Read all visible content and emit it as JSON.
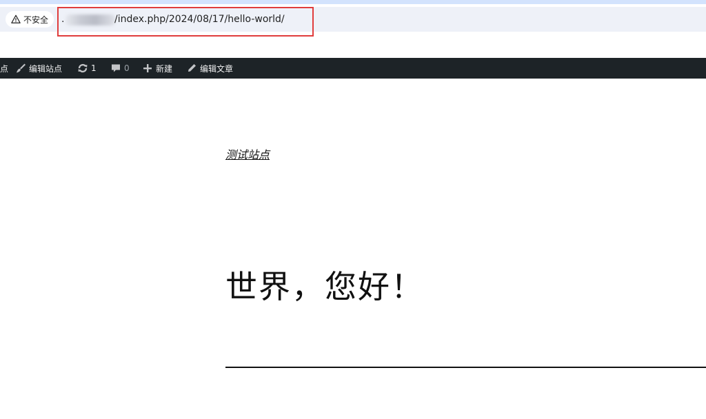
{
  "browser": {
    "security_label": "不安全",
    "url_dot": ".",
    "url_path": "/index.php/2024/08/17/hello-world/",
    "highlight_color": "#e03c3c"
  },
  "admin_bar": {
    "site_name_fragment": "点",
    "edit_site_label": "编辑站点",
    "updates_count": "1",
    "comments_count": "0",
    "new_label": "新建",
    "edit_post_label": "编辑文章",
    "icons": [
      "customize-brush-icon",
      "updates-icon",
      "comment-icon",
      "plus-icon",
      "pencil-icon"
    ],
    "background": "#1d2327"
  },
  "post": {
    "site_title": "测试站点",
    "title": "世界，您好！"
  }
}
